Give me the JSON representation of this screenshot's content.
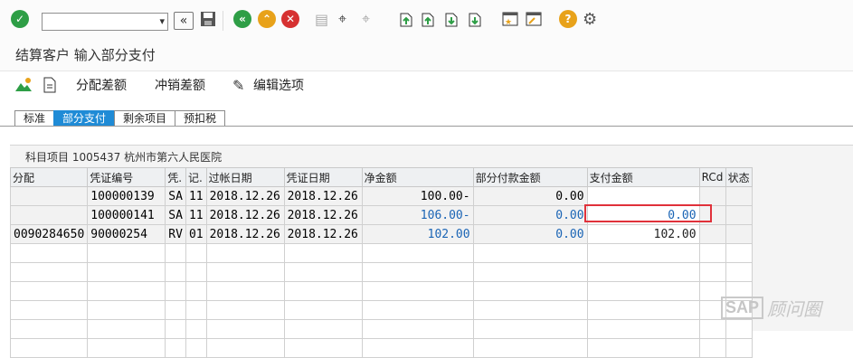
{
  "toolbar": {
    "command_field_value": "",
    "icons": [
      "check-icon",
      "back-double-icon",
      "save-icon",
      "back-icon",
      "exit-icon",
      "cancel-icon",
      "print-icon",
      "find-icon",
      "find-next-icon",
      "first-page-icon",
      "prev-page-icon",
      "next-page-icon",
      "last-page-icon",
      "new-session-icon",
      "shortcut-icon",
      "help-icon",
      "settings-icon"
    ]
  },
  "title": "结算客户 输入部分支付",
  "appbar": {
    "item1_label": "分配差额",
    "item2_label": "冲销差额",
    "item3_label": "编辑选项"
  },
  "tabs": [
    {
      "label": "标准"
    },
    {
      "label": "部分支付"
    },
    {
      "label": "剩余项目"
    },
    {
      "label": "预扣税"
    }
  ],
  "pane_title": "科目项目 1005437 杭州市第六人民医院",
  "grid": {
    "columns": [
      "分配",
      "凭证编号",
      "凭.",
      "记.",
      "过帐日期",
      "凭证日期",
      "净金额",
      "部分付款金额",
      "支付金额",
      "RCd",
      "状态"
    ],
    "rows": [
      {
        "c0": "",
        "c1": "100000139",
        "c2": "SA",
        "c3": "11",
        "c4": "2018.12.26",
        "c5": "2018.12.26",
        "c6": "100.00-",
        "c7": "0.00",
        "c8": "",
        "c9": "",
        "c10": ""
      },
      {
        "c0": "",
        "c1": "100000141",
        "c2": "SA",
        "c3": "11",
        "c4": "2018.12.26",
        "c5": "2018.12.26",
        "c6": "106.00-",
        "c7": "0.00",
        "c8": "0.00",
        "c9": "",
        "c10": ""
      },
      {
        "c0": "0090284650",
        "c1": "90000254",
        "c2": "RV",
        "c3": "01",
        "c4": "2018.12.26",
        "c5": "2018.12.26",
        "c6": "102.00",
        "c7": "0.00",
        "c8": "102.00",
        "c9": "",
        "c10": ""
      }
    ]
  },
  "watermark": {
    "sap": "SAP",
    "text": "顾问圈"
  },
  "colors": {
    "tab_active": "#1f8bd6",
    "highlight_border": "#e0313a",
    "value_blue": "#1a64b5"
  }
}
